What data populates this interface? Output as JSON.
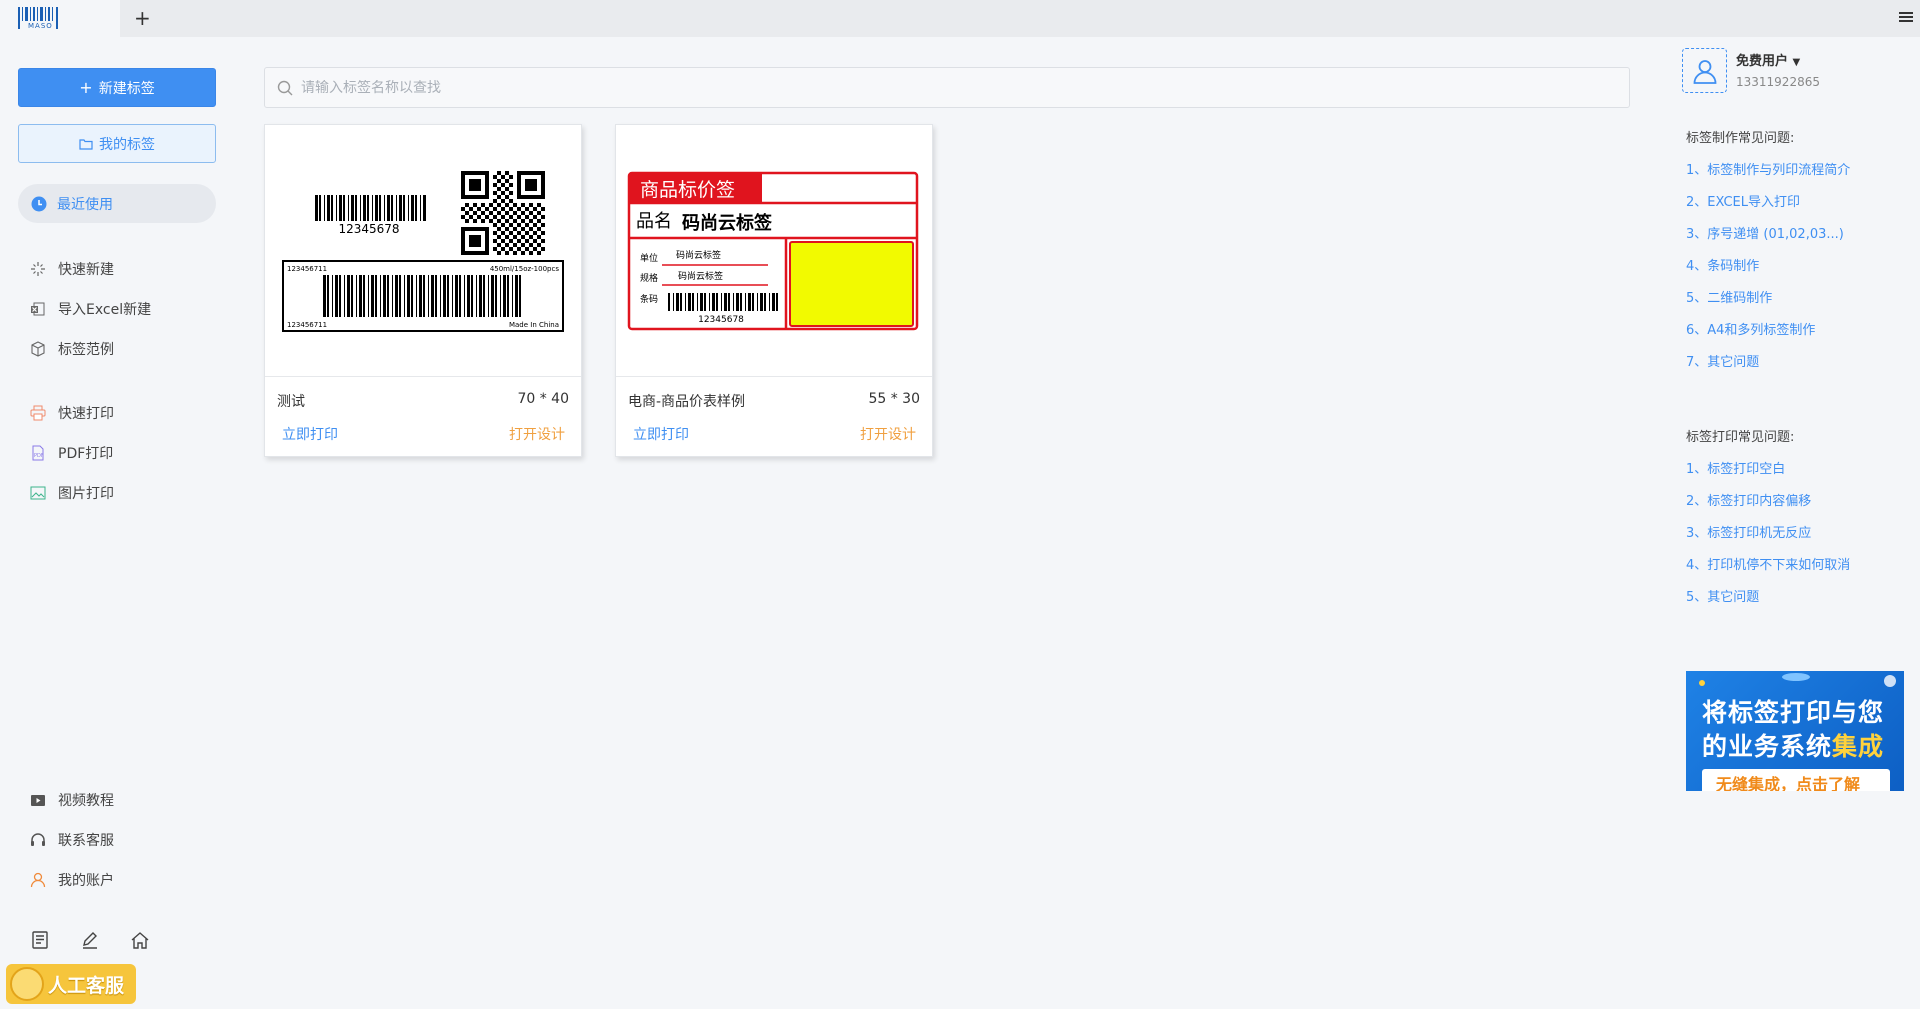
{
  "app": {
    "logo_text": "MASO",
    "new_tab": "+"
  },
  "sidebar": {
    "new_label": "新建标签",
    "mine_label": "我的标签",
    "recent_label": "最近使用",
    "items": [
      {
        "label": "快速新建",
        "icon": "sparkle-icon"
      },
      {
        "label": "导入Excel新建",
        "icon": "excel-icon"
      },
      {
        "label": "标签范例",
        "icon": "box-icon"
      },
      {
        "label": "快速打印",
        "icon": "printer-icon"
      },
      {
        "label": "PDF打印",
        "icon": "pdf-icon"
      },
      {
        "label": "图片打印",
        "icon": "image-icon"
      }
    ],
    "bottom_items": [
      {
        "label": "视频教程",
        "icon": "video-icon"
      },
      {
        "label": "联系客服",
        "icon": "headset-icon"
      },
      {
        "label": "我的账户",
        "icon": "user-icon"
      }
    ],
    "support_label": "人工客服"
  },
  "search": {
    "placeholder": "请输入标签名称以查找"
  },
  "cards": [
    {
      "name": "测试",
      "size": "70 * 40",
      "print": "立即打印",
      "design": "打开设计",
      "preview": {
        "barcode_text": "12345678",
        "box_left_top": "123456711",
        "box_right_top": "450ml/15oz-100pcs",
        "box_left_bottom": "123456711",
        "box_right_bottom": "Made In China"
      }
    },
    {
      "name": "电商-商品价表样例",
      "size": "55 * 30",
      "print": "立即打印",
      "design": "打开设计",
      "preview": {
        "header": "商品标价签",
        "product_label": "品名",
        "product_value": "码尚云标签",
        "unit_label": "单位",
        "unit_value": "码尚云标签",
        "spec_label": "规格",
        "spec_value": "码尚云标签",
        "code_label": "条码",
        "code_value": "12345678"
      }
    }
  ],
  "user": {
    "name": "免费用户",
    "phone": "13311922865"
  },
  "faq_make": {
    "title": "标签制作常见问题:",
    "links": [
      "1、标签制作与列印流程简介",
      "2、EXCEL导入打印",
      "3、序号递增 (01,02,03...)",
      "4、条码制作",
      "5、二维码制作",
      "6、A4和多列标签制作",
      "7、其它问题"
    ]
  },
  "faq_print": {
    "title": "标签打印常见问题:",
    "links": [
      "1、标签打印空白",
      "2、标签打印内容偏移",
      "3、标签打印机无反应",
      "4、打印机停不下来如何取消",
      "5、其它问题"
    ]
  },
  "ad": {
    "line1": "将标签打印与您",
    "line2_a": "的业务系统",
    "line2_b": "集成",
    "cta": "无缝集成，点击了解"
  },
  "colors": {
    "primary": "#3f8ff2",
    "accent_orange": "#f0a040",
    "label_red": "#e0141e",
    "label_yellow": "#f2fa00"
  }
}
